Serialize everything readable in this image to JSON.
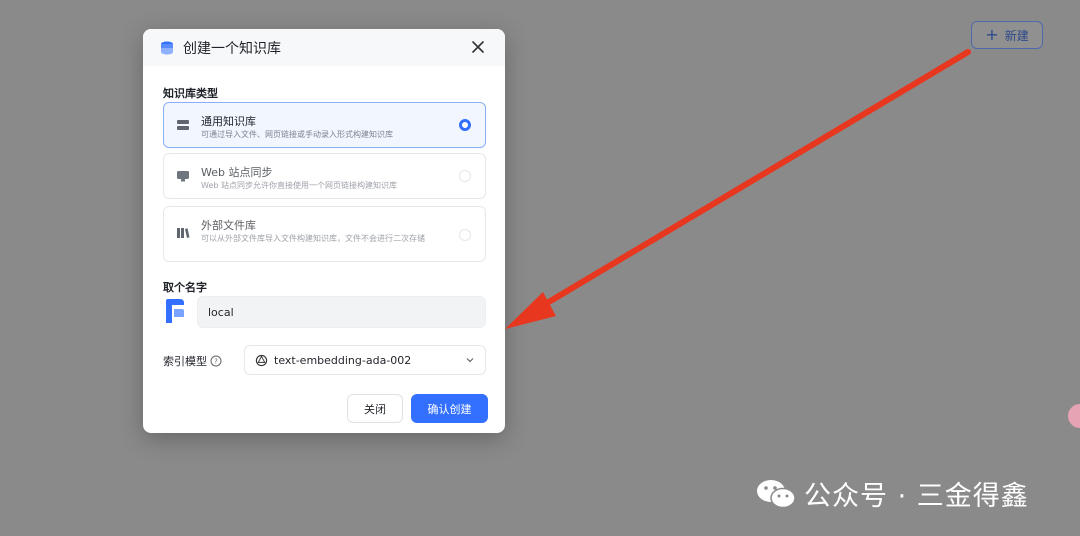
{
  "header": {
    "new_label": "新建"
  },
  "modal": {
    "title": "创建一个知识库",
    "type_section_label": "知识库类型",
    "options": [
      {
        "title": "通用知识库",
        "desc": "可通过导入文件、网页链接或手动录入形式构建知识库",
        "selected": true
      },
      {
        "title": "Web 站点同步",
        "desc": "Web 站点同步允许你直接使用一个网页链接构建知识库",
        "selected": false
      },
      {
        "title": "外部文件库",
        "desc": "可以从外部文件库导入文件构建知识库，文件不会进行二次存储",
        "selected": false
      }
    ],
    "name_section_label": "取个名字",
    "name_value": "local",
    "index_model_label": "索引模型",
    "index_model_value": "text-embedding-ada-002",
    "close_label": "关闭",
    "confirm_label": "确认创建"
  },
  "watermark": {
    "text": "公众号 · 三金得鑫"
  },
  "colors": {
    "accent": "#3370ff",
    "arrow": "#e8371f",
    "backdrop": "#8a8a8a"
  }
}
